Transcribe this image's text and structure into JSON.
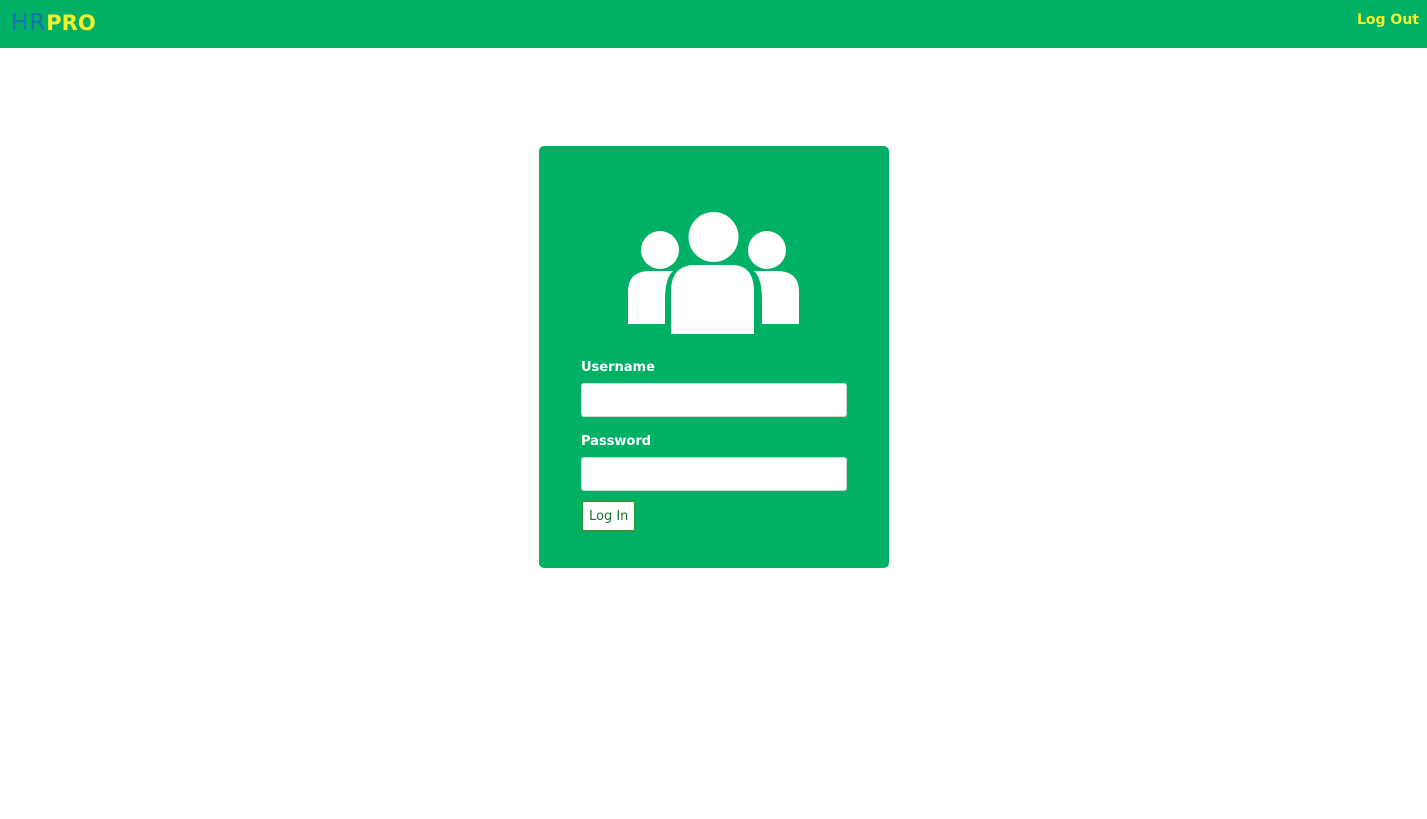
{
  "navbar": {
    "brand_hr": "HR",
    "brand_pro": "PRO",
    "logout_label": "Log Out",
    "background_color": "#00b165",
    "accent_color": "#f4ef2a",
    "brand_hr_color": "#1f6fb5"
  },
  "login": {
    "icon": "users-group-icon",
    "username_label": "Username",
    "username_value": "",
    "password_label": "Password",
    "password_value": "",
    "submit_label": "Log In",
    "card_color": "#00b165"
  }
}
